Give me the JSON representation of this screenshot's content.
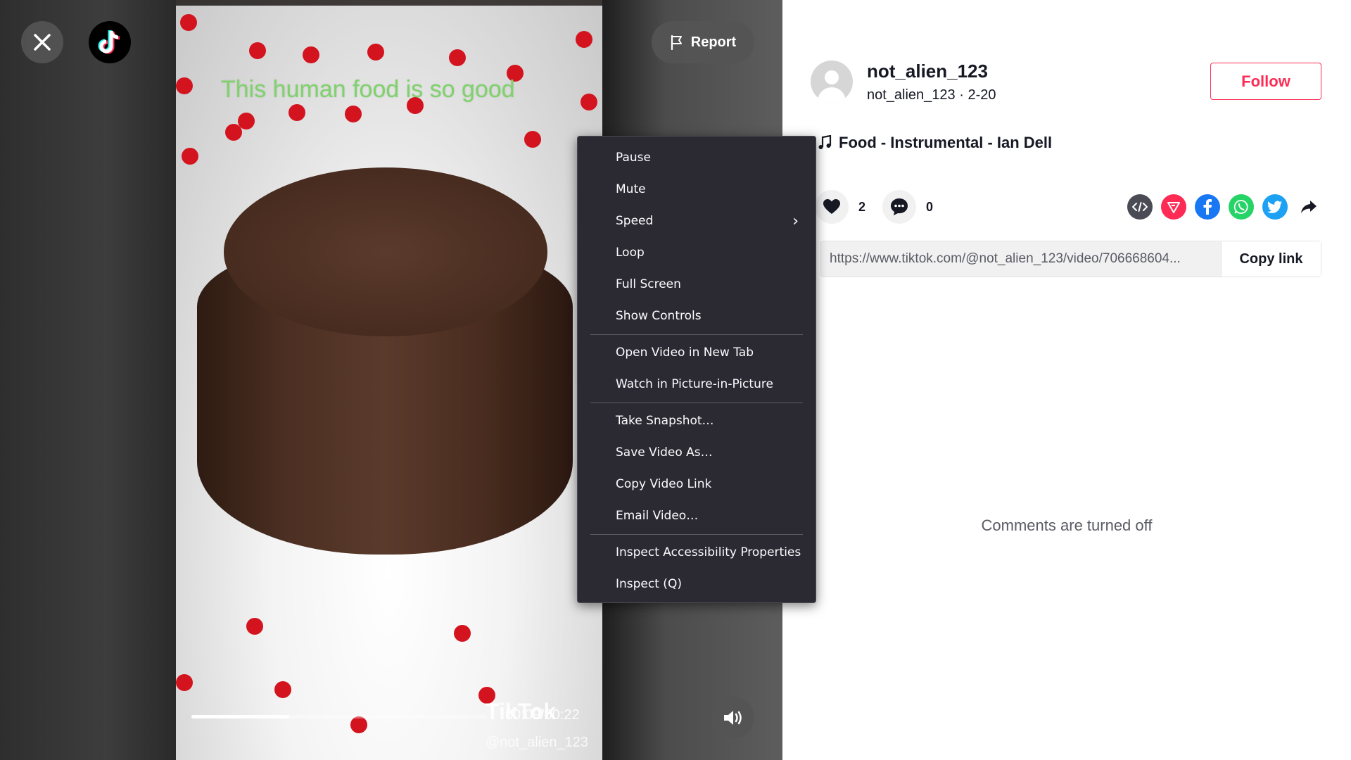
{
  "video": {
    "caption": "This human food is so good",
    "watermark": "TikTok",
    "watermark_user": "@not_alien_123",
    "time": "00:09/00:22",
    "progress": 0.33,
    "report_label": "Report"
  },
  "context_menu": {
    "groups": [
      [
        {
          "label": "Pause"
        },
        {
          "label": "Mute"
        },
        {
          "label": "Speed",
          "submenu": true
        },
        {
          "label": "Loop"
        },
        {
          "label": "Full Screen"
        },
        {
          "label": "Show Controls"
        }
      ],
      [
        {
          "label": "Open Video in New Tab"
        },
        {
          "label": "Watch in Picture-in-Picture"
        }
      ],
      [
        {
          "label": "Take Snapshot…"
        },
        {
          "label": "Save Video As…"
        },
        {
          "label": "Copy Video Link"
        },
        {
          "label": "Email Video…"
        }
      ],
      [
        {
          "label": "Inspect Accessibility Properties"
        },
        {
          "label": "Inspect (Q)"
        }
      ]
    ]
  },
  "profile": {
    "username": "not_alien_123",
    "subline": "not_alien_123 · 2-20",
    "follow_label": "Follow",
    "music": "Food - Instrumental - Ian Dell",
    "likes": "2",
    "comments": "0",
    "link": "https://www.tiktok.com/@not_alien_123/video/706668604...",
    "copy_label": "Copy link",
    "comments_off": "Comments are turned off"
  },
  "share_icons": [
    "embed-icon",
    "send-icon",
    "facebook-icon",
    "whatsapp-icon",
    "twitter-icon",
    "share-arrow-icon"
  ],
  "colors": {
    "accent": "#fe2c55",
    "menu_bg": "#2b2a33",
    "facebook": "#1877f2",
    "whatsapp": "#25d366",
    "twitter": "#1da1f2"
  }
}
